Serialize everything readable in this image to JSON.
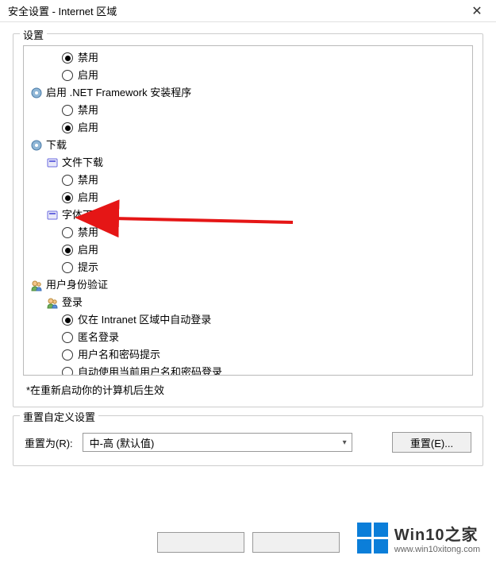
{
  "window": {
    "title": "安全设置 - Internet 区域"
  },
  "settings": {
    "groupTitle": "设置",
    "tree": [
      {
        "indent": 2,
        "type": "radio",
        "checked": true,
        "label": "禁用"
      },
      {
        "indent": 2,
        "type": "radio",
        "checked": false,
        "label": "启用"
      },
      {
        "indent": 0,
        "type": "category",
        "icon": "gear",
        "label": "启用 .NET Framework 安装程序"
      },
      {
        "indent": 2,
        "type": "radio",
        "checked": false,
        "label": "禁用"
      },
      {
        "indent": 2,
        "type": "radio",
        "checked": true,
        "label": "启用"
      },
      {
        "indent": 0,
        "type": "category",
        "icon": "gear",
        "label": "下载"
      },
      {
        "indent": 1,
        "type": "category",
        "icon": "box",
        "label": "文件下载"
      },
      {
        "indent": 2,
        "type": "radio",
        "checked": false,
        "label": "禁用"
      },
      {
        "indent": 2,
        "type": "radio",
        "checked": true,
        "label": "启用"
      },
      {
        "indent": 1,
        "type": "category",
        "icon": "box",
        "label": "字体下载"
      },
      {
        "indent": 2,
        "type": "radio",
        "checked": false,
        "label": "禁用"
      },
      {
        "indent": 2,
        "type": "radio",
        "checked": true,
        "label": "启用"
      },
      {
        "indent": 2,
        "type": "radio",
        "checked": false,
        "label": "提示"
      },
      {
        "indent": 0,
        "type": "category",
        "icon": "user",
        "label": "用户身份验证"
      },
      {
        "indent": 1,
        "type": "category",
        "icon": "user",
        "label": "登录"
      },
      {
        "indent": 2,
        "type": "radio",
        "checked": true,
        "label": "仅在 Intranet 区域中自动登录"
      },
      {
        "indent": 2,
        "type": "radio",
        "checked": false,
        "label": "匿名登录"
      },
      {
        "indent": 2,
        "type": "radio",
        "checked": false,
        "label": "用户名和密码提示"
      },
      {
        "indent": 2,
        "type": "radio",
        "checked": false,
        "label": "自动使用当前用户名和密码登录"
      }
    ],
    "note": "*在重新启动你的计算机后生效"
  },
  "reset": {
    "groupTitle": "重置自定义设置",
    "label": "重置为(R):",
    "selected": "中-高 (默认值)",
    "button": "重置(E)..."
  },
  "watermark": {
    "title": "Win10之家",
    "url": "www.win10xitong.com"
  }
}
